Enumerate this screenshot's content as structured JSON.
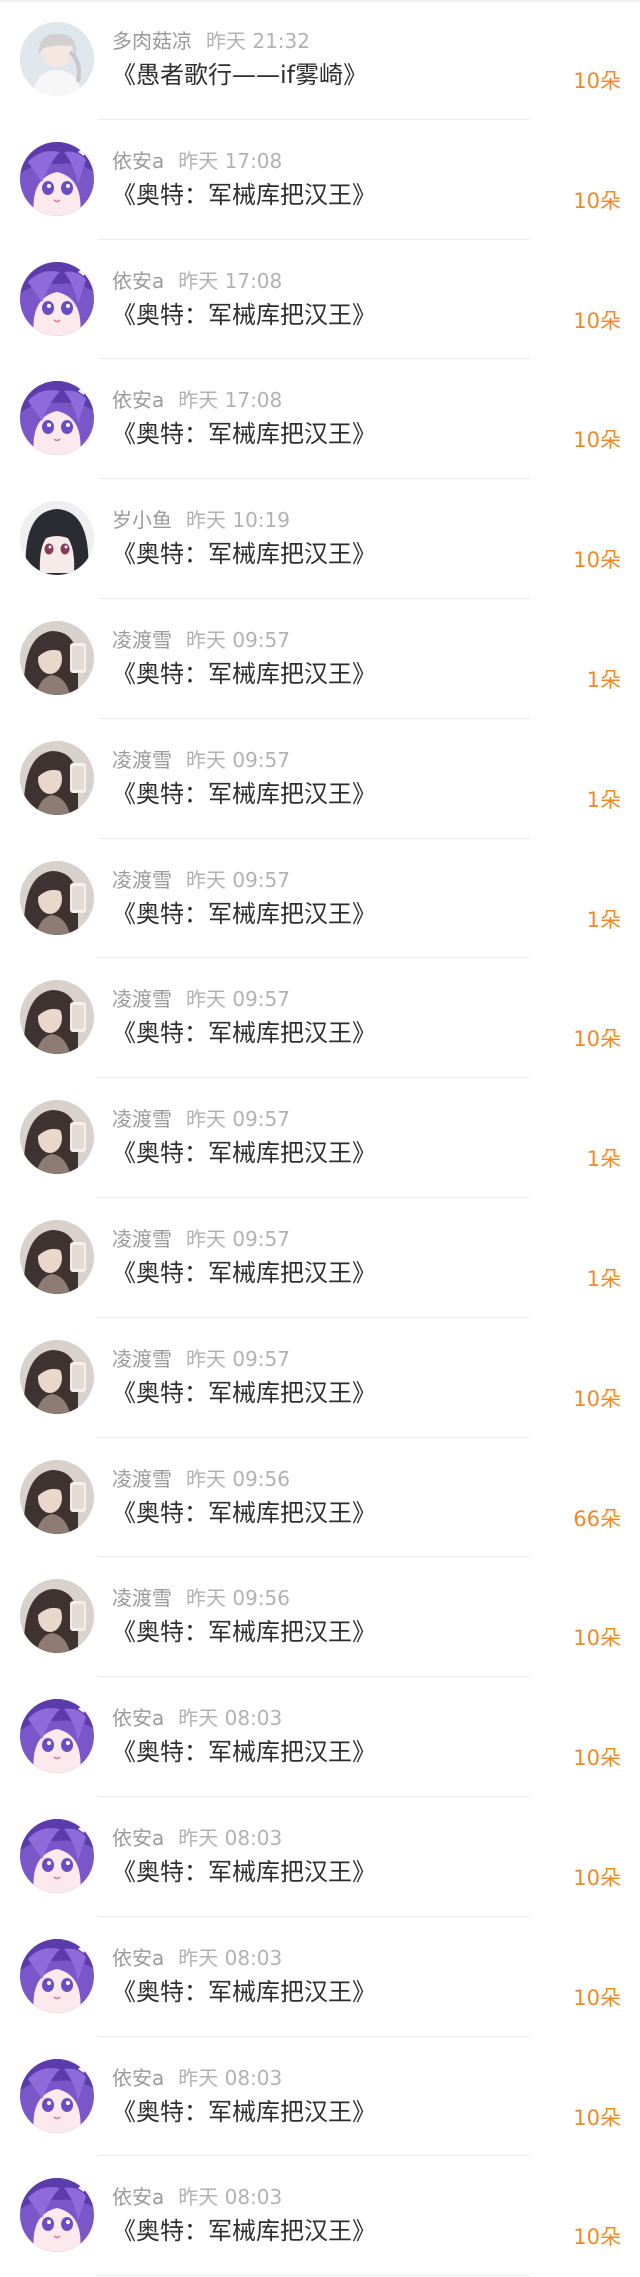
{
  "gift_list": [
    {
      "user": "多肉菇凉",
      "time": "昨天 21:32",
      "book": "《愚者歌行——if雾崎》",
      "amount": "10朵",
      "avatar": "avatar-girl-white-icon"
    },
    {
      "user": "依安a",
      "time": "昨天 17:08",
      "book": "《奥特：军械库把汉王》",
      "amount": "10朵",
      "avatar": "avatar-anime-purple-icon"
    },
    {
      "user": "依安a",
      "time": "昨天 17:08",
      "book": "《奥特：军械库把汉王》",
      "amount": "10朵",
      "avatar": "avatar-anime-purple-icon"
    },
    {
      "user": "依安a",
      "time": "昨天 17:08",
      "book": "《奥特：军械库把汉王》",
      "amount": "10朵",
      "avatar": "avatar-anime-purple-icon"
    },
    {
      "user": "岁小鱼",
      "time": "昨天 10:19",
      "book": "《奥特：军械库把汉王》",
      "amount": "10朵",
      "avatar": "avatar-anime-dark-icon"
    },
    {
      "user": "凌渡雪",
      "time": "昨天 09:57",
      "book": "《奥特：军械库把汉王》",
      "amount": "1朵",
      "avatar": "avatar-selfie-icon"
    },
    {
      "user": "凌渡雪",
      "time": "昨天 09:57",
      "book": "《奥特：军械库把汉王》",
      "amount": "1朵",
      "avatar": "avatar-selfie-icon"
    },
    {
      "user": "凌渡雪",
      "time": "昨天 09:57",
      "book": "《奥特：军械库把汉王》",
      "amount": "1朵",
      "avatar": "avatar-selfie-icon"
    },
    {
      "user": "凌渡雪",
      "time": "昨天 09:57",
      "book": "《奥特：军械库把汉王》",
      "amount": "10朵",
      "avatar": "avatar-selfie-icon"
    },
    {
      "user": "凌渡雪",
      "time": "昨天 09:57",
      "book": "《奥特：军械库把汉王》",
      "amount": "1朵",
      "avatar": "avatar-selfie-icon"
    },
    {
      "user": "凌渡雪",
      "time": "昨天 09:57",
      "book": "《奥特：军械库把汉王》",
      "amount": "1朵",
      "avatar": "avatar-selfie-icon"
    },
    {
      "user": "凌渡雪",
      "time": "昨天 09:57",
      "book": "《奥特：军械库把汉王》",
      "amount": "10朵",
      "avatar": "avatar-selfie-icon"
    },
    {
      "user": "凌渡雪",
      "time": "昨天 09:56",
      "book": "《奥特：军械库把汉王》",
      "amount": "66朵",
      "avatar": "avatar-selfie-icon"
    },
    {
      "user": "凌渡雪",
      "time": "昨天 09:56",
      "book": "《奥特：军械库把汉王》",
      "amount": "10朵",
      "avatar": "avatar-selfie-icon"
    },
    {
      "user": "依安a",
      "time": "昨天 08:03",
      "book": "《奥特：军械库把汉王》",
      "amount": "10朵",
      "avatar": "avatar-anime-purple-icon"
    },
    {
      "user": "依安a",
      "time": "昨天 08:03",
      "book": "《奥特：军械库把汉王》",
      "amount": "10朵",
      "avatar": "avatar-anime-purple-icon"
    },
    {
      "user": "依安a",
      "time": "昨天 08:03",
      "book": "《奥特：军械库把汉王》",
      "amount": "10朵",
      "avatar": "avatar-anime-purple-icon"
    },
    {
      "user": "依安a",
      "time": "昨天 08:03",
      "book": "《奥特：军械库把汉王》",
      "amount": "10朵",
      "avatar": "avatar-anime-purple-icon"
    },
    {
      "user": "依安a",
      "time": "昨天 08:03",
      "book": "《奥特：军械库把汉王》",
      "amount": "10朵",
      "avatar": "avatar-anime-purple-icon"
    }
  ],
  "colors": {
    "amount": "#ee8a2a",
    "username": "#9a9a9a",
    "time": "#b2b2b2",
    "title": "#2e2e2e",
    "divider": "#ececec"
  }
}
